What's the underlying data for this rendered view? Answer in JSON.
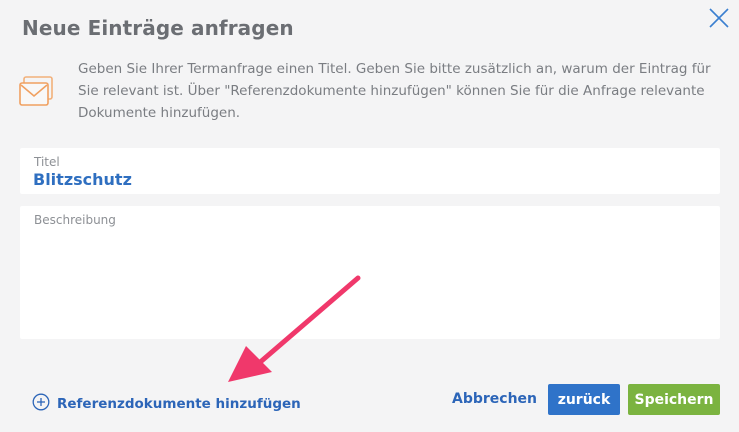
{
  "dialog": {
    "title": "Neue Einträge anfragen",
    "close_icon": "close-x-icon",
    "intro_icon": "envelope-icon",
    "intro_text": "Geben Sie Ihrer Termanfrage einen Titel. Geben Sie bitte zusätzlich an, warum der Eintrag für Sie relevant ist. Über \"Referenzdokumente hinzufügen\" können Sie für die Anfrage relevante Dokumente hinzufügen."
  },
  "form": {
    "title_field": {
      "label": "Titel",
      "value": "Blitzschutz"
    },
    "description_field": {
      "label": "Beschreibung",
      "value": ""
    }
  },
  "footer": {
    "add_docs_icon": "plus-circle-icon",
    "add_docs_label": "Referenzdokumente hinzufügen",
    "cancel_label": "Abbrechen",
    "back_label": "zurück",
    "save_label": "Speichern"
  },
  "colors": {
    "accent_blue": "#2f73c9",
    "save_green": "#7bb340",
    "annotation_arrow": "#f0386b",
    "value_blue": "#2f6fc0"
  }
}
